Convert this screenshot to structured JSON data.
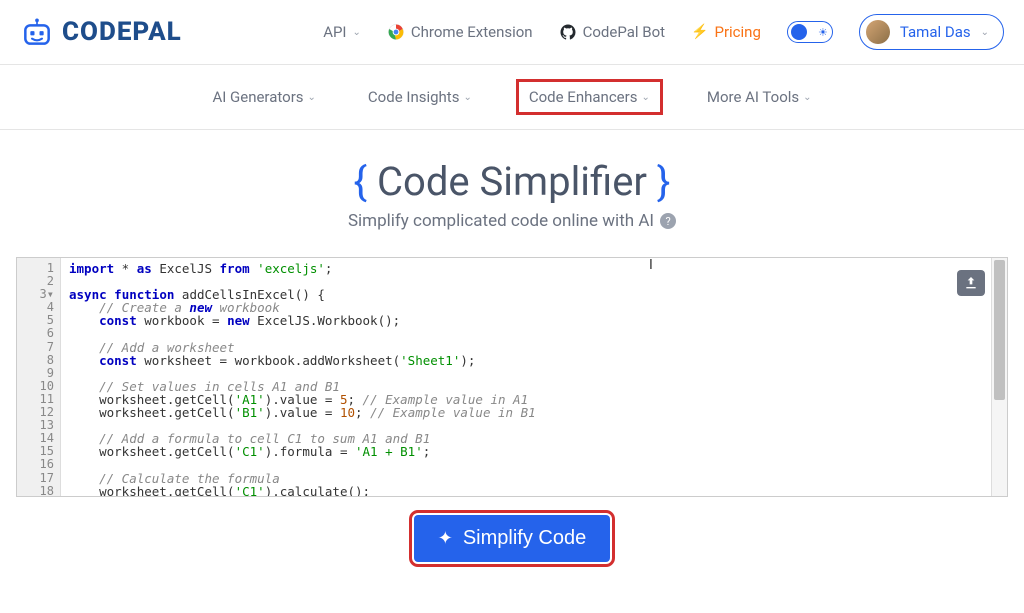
{
  "brand": {
    "name": "CODEPAL"
  },
  "header": {
    "api": "API",
    "chrome": "Chrome Extension",
    "bot": "CodePal Bot",
    "pricing": "Pricing",
    "user": "Tamal Das"
  },
  "subnav": {
    "generators": "AI Generators",
    "insights": "Code Insights",
    "enhancers": "Code Enhancers",
    "more": "More AI Tools"
  },
  "page": {
    "title": "Code Simplifier",
    "subtitle": "Simplify complicated code online with AI"
  },
  "editor": {
    "lines": [
      "import * as ExcelJS from 'exceljs';",
      "",
      "async function addCellsInExcel() {",
      "    // Create a new workbook",
      "    const workbook = new ExcelJS.Workbook();",
      "",
      "    // Add a worksheet",
      "    const worksheet = workbook.addWorksheet('Sheet1');",
      "",
      "    // Set values in cells A1 and B1",
      "    worksheet.getCell('A1').value = 5; // Example value in A1",
      "    worksheet.getCell('B1').value = 10; // Example value in B1",
      "",
      "    // Add a formula to cell C1 to sum A1 and B1",
      "    worksheet.getCell('C1').formula = 'A1 + B1';",
      "",
      "    // Calculate the formula",
      "    worksheet.getCell('C1').calculate();"
    ],
    "line_count": 18
  },
  "action": {
    "label": "Simplify Code"
  },
  "colors": {
    "primary": "#2563eb",
    "accent_orange": "#f97316",
    "highlight": "#d32f2f"
  }
}
